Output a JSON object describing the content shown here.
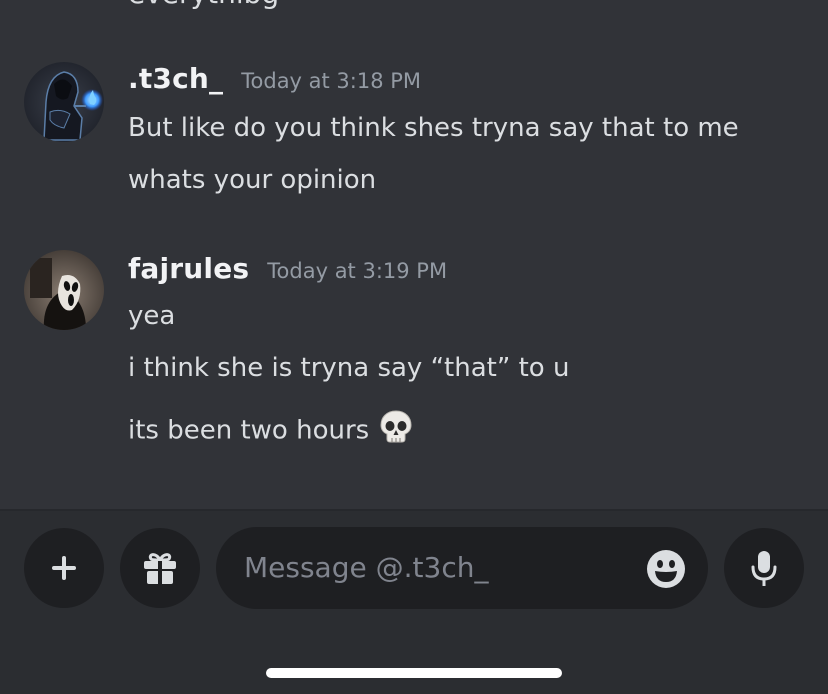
{
  "previous_message_fragment": "everythibg",
  "messages": [
    {
      "username": ".t3ch_",
      "timestamp": "Today at 3:18 PM",
      "lines": [
        "But like do you think shes tryna say that to me",
        "whats your opinion"
      ],
      "avatar_icon": "hooded-figure-blue-flame"
    },
    {
      "username": "fajrules",
      "timestamp": "Today at 3:19 PM",
      "lines": [
        "yea",
        "i think she is tryna say “that” to u",
        "its been two hours"
      ],
      "last_line_emoji": "skull-emoji",
      "avatar_icon": "ghostface-mask"
    }
  ],
  "composer": {
    "placeholder": "Message @.t3ch_",
    "add_icon": "plus-icon",
    "gift_icon": "gift-icon",
    "emoji_icon": "smiley-icon",
    "mic_icon": "microphone-icon"
  },
  "colors": {
    "background": "#313338",
    "composer_bg": "#2b2d31",
    "input_bg": "#1e1f22",
    "text": "#dbdee1",
    "muted": "#949ba4"
  }
}
